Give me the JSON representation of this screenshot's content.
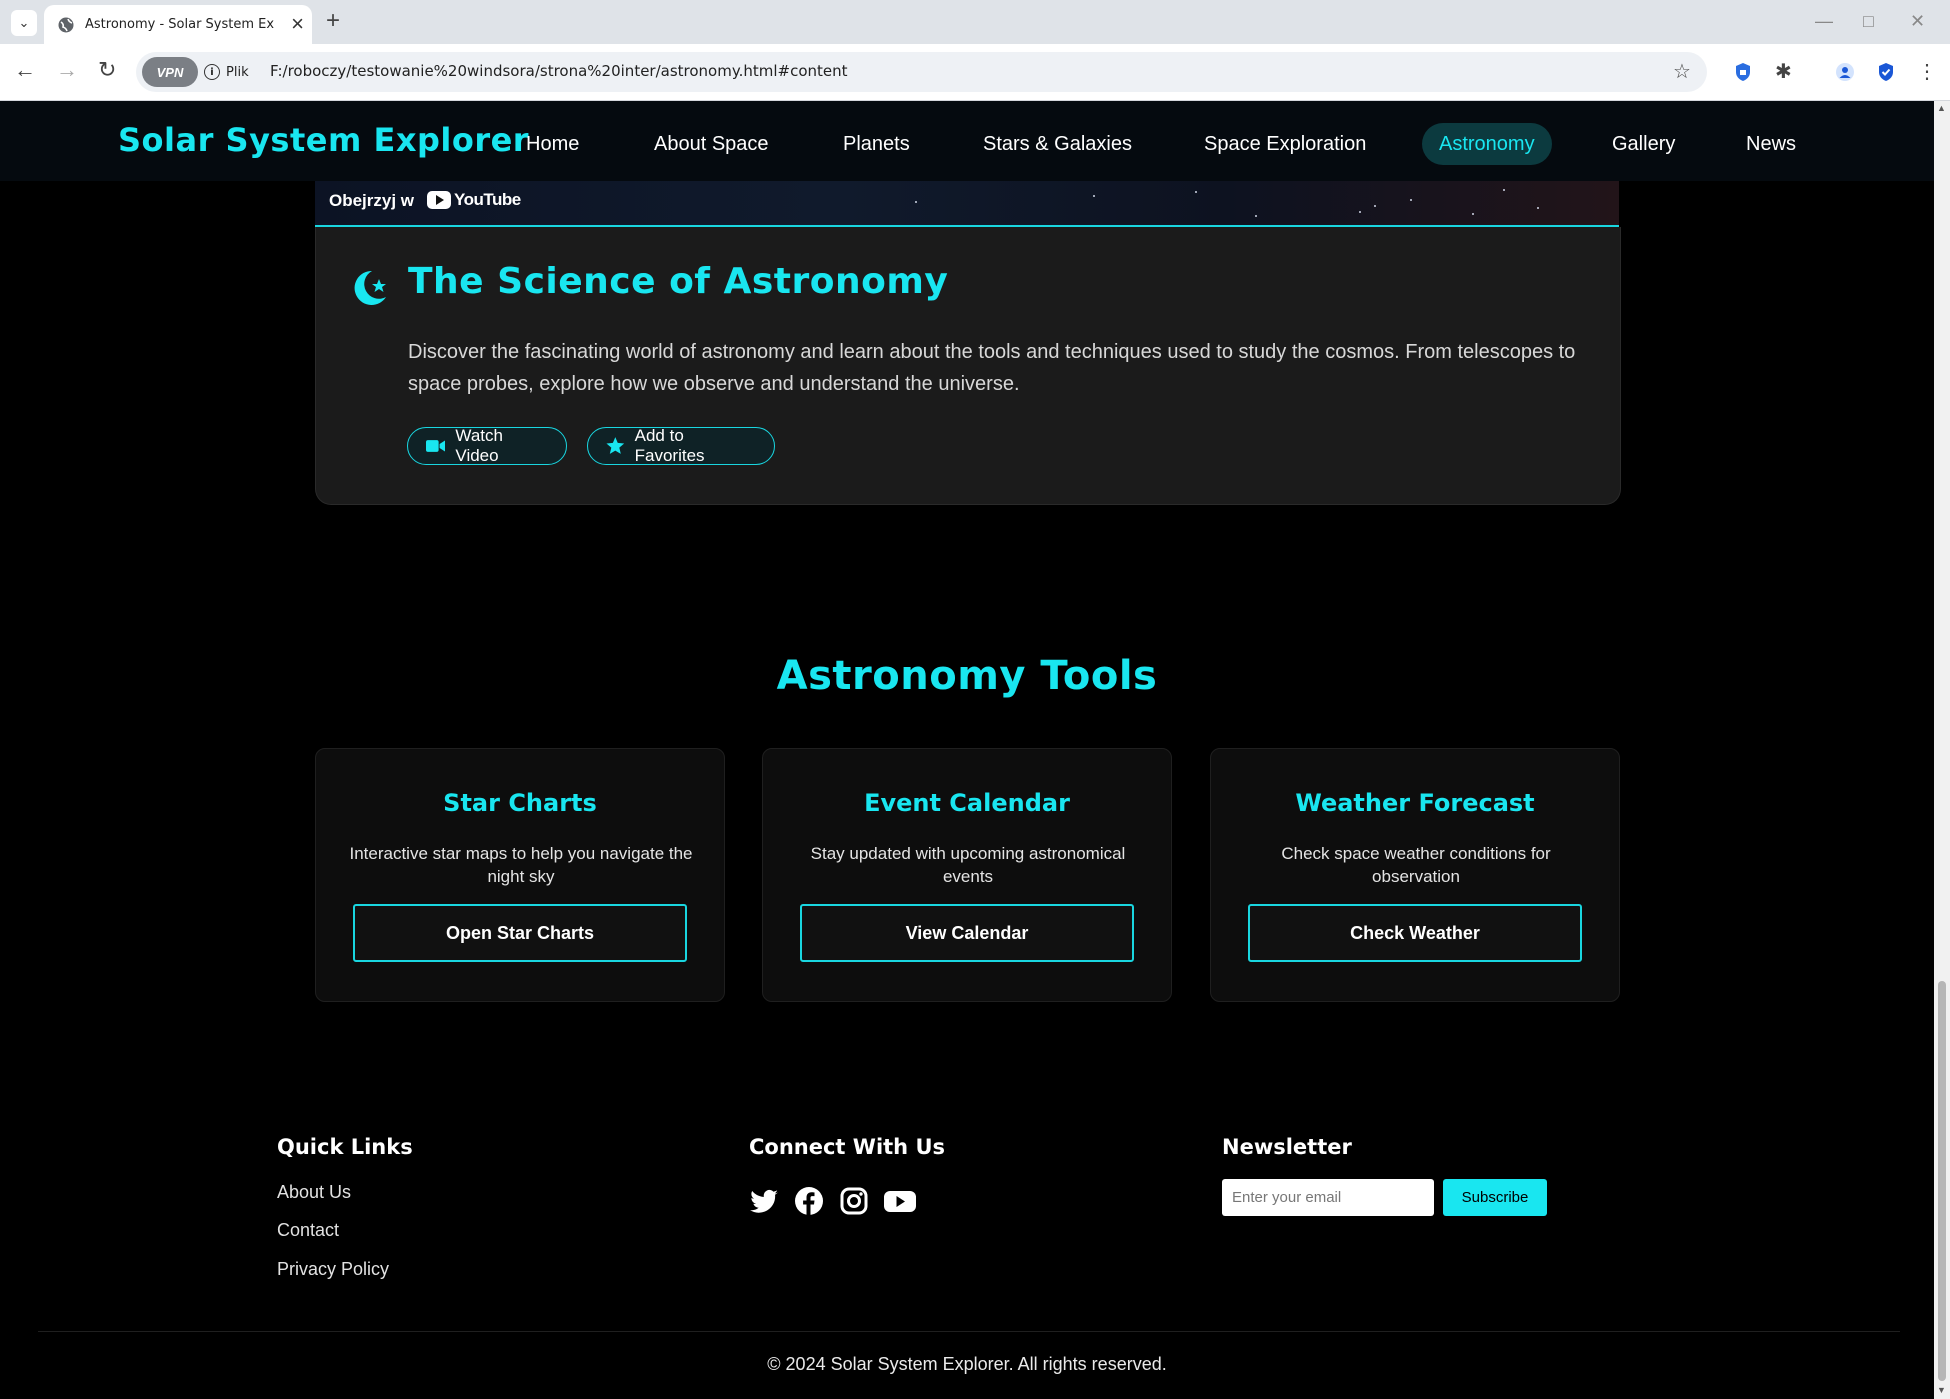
{
  "browser": {
    "tab_title": "Astronomy - Solar System Explorer",
    "new_tab": "+",
    "vpn_label": "VPN",
    "info_label": "Plik",
    "url": "F:/roboczy/testowanie%20windsora/strona%20inter/astronomy.html#content"
  },
  "site": {
    "brand": "Solar System Explorer",
    "nav": [
      "Home",
      "About Space",
      "Planets",
      "Stars & Galaxies",
      "Space Exploration",
      "Astronomy",
      "Gallery",
      "News"
    ],
    "active_nav": "Astronomy",
    "accent_color": "#19e6f0"
  },
  "video": {
    "watch_on": "Obejrzyj w",
    "youtube": "YouTube"
  },
  "science": {
    "title": "The Science of Astronomy",
    "description": "Discover the fascinating world of astronomy and learn about the tools and techniques used to study the cosmos. From telescopes to space probes, explore how we observe and understand the universe.",
    "watch_video": "Watch Video",
    "add_favorites": "Add to Favorites"
  },
  "tools": {
    "title": "Astronomy Tools",
    "cards": [
      {
        "title": "Star Charts",
        "desc": "Interactive star maps to help you navigate the night sky",
        "button": "Open Star Charts"
      },
      {
        "title": "Event Calendar",
        "desc": "Stay updated with upcoming astronomical events",
        "button": "View Calendar"
      },
      {
        "title": "Weather Forecast",
        "desc": "Check space weather conditions for observation",
        "button": "Check Weather"
      }
    ]
  },
  "footer": {
    "quick_links_title": "Quick Links",
    "links": [
      "About Us",
      "Contact",
      "Privacy Policy"
    ],
    "connect_title": "Connect With Us",
    "social_icons": [
      "twitter-icon",
      "facebook-icon",
      "instagram-icon",
      "youtube-icon"
    ],
    "newsletter_title": "Newsletter",
    "email_placeholder": "Enter your email",
    "subscribe": "Subscribe",
    "copyright": "© 2024 Solar System Explorer. All rights reserved."
  }
}
